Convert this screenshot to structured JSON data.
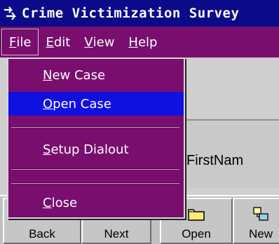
{
  "window": {
    "title": "Crime Victimization Survey"
  },
  "menubar": {
    "items": [
      {
        "label": "File",
        "underline": "F",
        "rest": "ile"
      },
      {
        "label": "Edit",
        "underline": "E",
        "rest": "dit"
      },
      {
        "label": "View",
        "underline": "V",
        "rest": "iew"
      },
      {
        "label": "Help",
        "underline": "H",
        "rest": "elp"
      }
    ]
  },
  "file_menu": {
    "items": [
      {
        "label": "New Case",
        "underline": "N",
        "rest": "ew Case",
        "highlighted": false
      },
      {
        "label": "Open Case",
        "underline": "O",
        "rest": "pen Case",
        "highlighted": true
      },
      {
        "label": "Setup Dialout",
        "underline": "S",
        "rest": "etup Dialout",
        "highlighted": false
      },
      {
        "label": "Close",
        "underline": "C",
        "rest": "lose",
        "highlighted": false
      }
    ]
  },
  "form": {
    "firstname_label": "FirstNam"
  },
  "toolbar": {
    "back_label": "Back",
    "next_label": "Next",
    "open_label": "Open",
    "new_label": "New"
  },
  "colors": {
    "titlebar": "#0b0b8a",
    "menubar": "#7a0e6e",
    "highlight": "#1010e0"
  }
}
